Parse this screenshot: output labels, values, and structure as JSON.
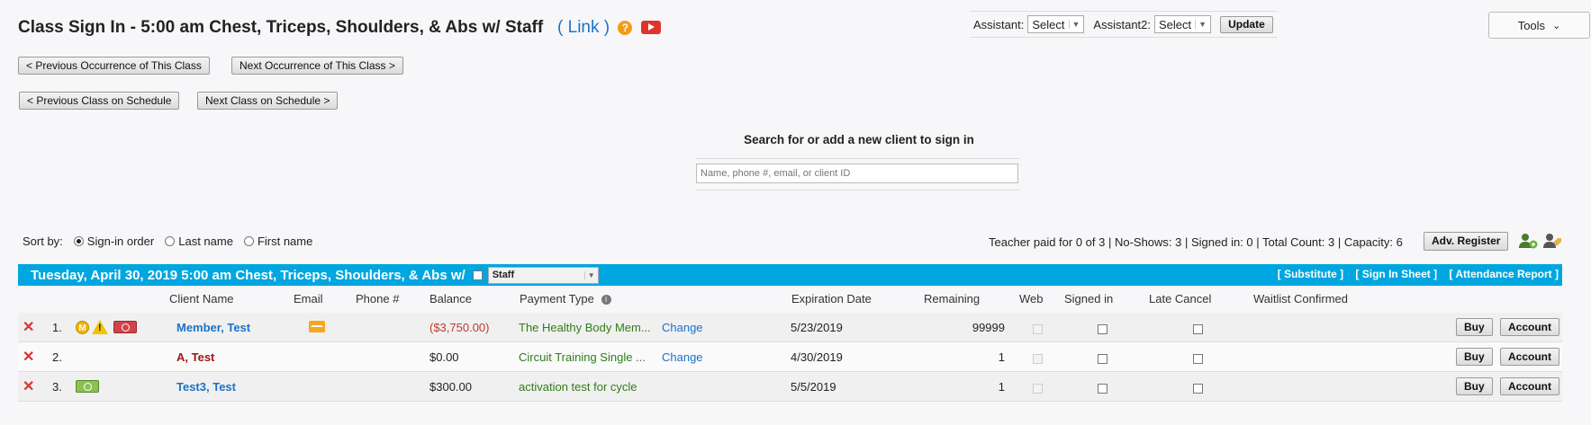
{
  "title": {
    "prefix": "Class Sign In  -  5:00 am   Chest, Triceps, Shoulders, & Abs w/  Staff",
    "link_open": "(",
    "link_label": "Link",
    "link_close": ")"
  },
  "assistant": {
    "label1": "Assistant:",
    "value1": "Select",
    "label2": "Assistant2:",
    "value2": "Select",
    "update_label": "Update"
  },
  "tools": {
    "label": "Tools"
  },
  "nav": {
    "prev_occurrence": "< Previous Occurrence of This Class",
    "next_occurrence": "Next Occurrence of This Class >",
    "prev_class": "< Previous Class on Schedule",
    "next_class": "Next Class on Schedule >"
  },
  "search": {
    "label": "Search for or add a new client to sign in",
    "placeholder": "Name, phone #, email, or client ID"
  },
  "sort": {
    "label": "Sort by:",
    "options": [
      "Sign-in order",
      "Last name",
      "First name"
    ],
    "selected": "Sign-in order"
  },
  "stats": {
    "text": "Teacher paid for 0 of 3 | No-Shows: 3 | Signed in: 0 |  Total Count: 3  | Capacity: 6",
    "adv_register": "Adv. Register"
  },
  "class_header": {
    "date_text": "Tuesday, April 30, 2019   5:00 am   Chest, Triceps, Shoulders, & Abs   w/",
    "staff_value": "Staff",
    "links": [
      "[ Substitute ]",
      "[ Sign In Sheet ]",
      "[ Attendance Report ]"
    ]
  },
  "columns": {
    "client_name": "Client Name",
    "email": "Email",
    "phone": "Phone #",
    "balance": "Balance",
    "payment_type": "Payment Type",
    "expiration": "Expiration Date",
    "remaining": "Remaining",
    "web": "Web",
    "signed_in": "Signed in",
    "late_cancel": "Late Cancel",
    "waitlist": "Waitlist Confirmed"
  },
  "rows": [
    {
      "num": "1.",
      "name": "Member, Test",
      "balance": "($3,750.00)",
      "payment": "The Healthy Body Mem...",
      "change": "Change",
      "expiration": "5/23/2019",
      "remaining": "99999",
      "buy": "Buy",
      "account": "Account"
    },
    {
      "num": "2.",
      "name": "A, Test",
      "balance": "$0.00",
      "payment": "Circuit Training Single ...",
      "change": "Change",
      "expiration": "4/30/2019",
      "remaining": "1",
      "buy": "Buy",
      "account": "Account"
    },
    {
      "num": "3.",
      "name": "Test3, Test",
      "balance": "$300.00",
      "payment": "activation test for cycle",
      "change": "",
      "expiration": "5/5/2019",
      "remaining": "1",
      "buy": "Buy",
      "account": "Account"
    }
  ],
  "icons": {
    "help": "help-icon",
    "video": "youtube-icon",
    "remove": "remove-icon",
    "membership": "membership-icon",
    "alert": "alert-icon",
    "ticket": "ticket-icon",
    "email": "email-icon"
  },
  "colors": {
    "header_bar": "#00a6df",
    "link": "#1a73c7",
    "negative": "#c0392b",
    "payment_green": "#2f7d17"
  }
}
